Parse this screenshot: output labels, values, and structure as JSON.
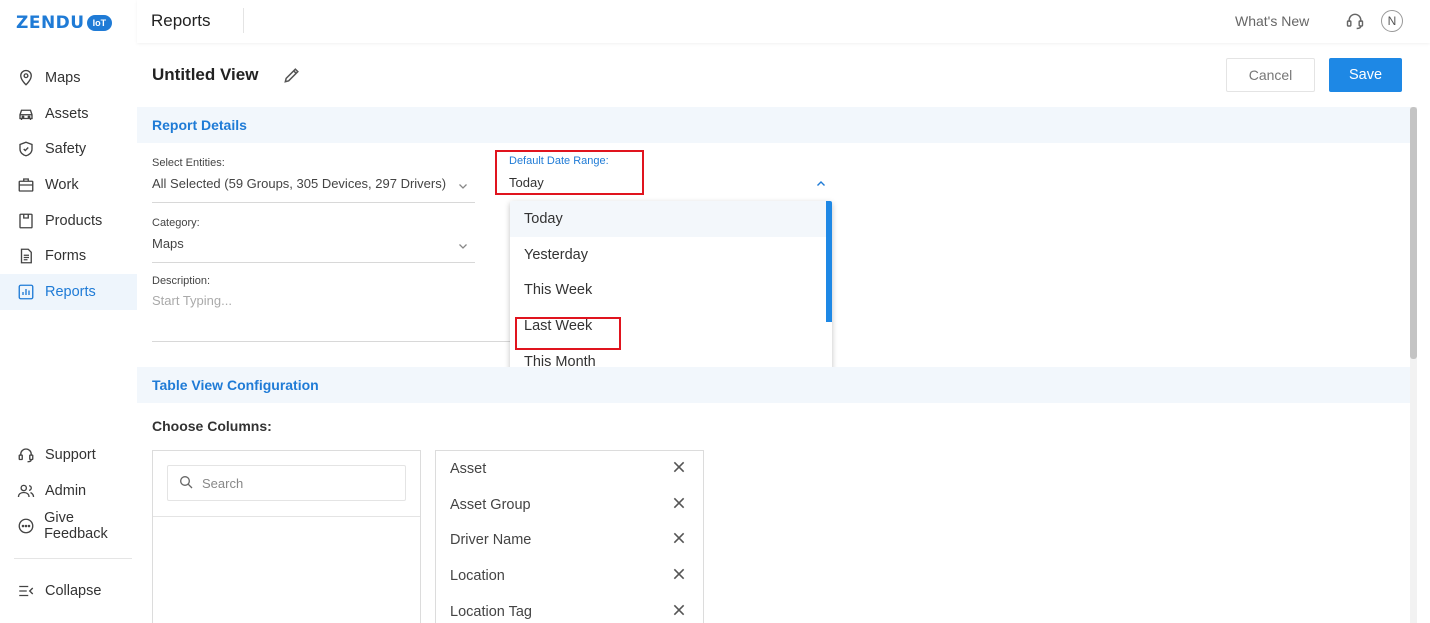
{
  "brand": {
    "logo_text": "ZENDU",
    "logo_badge": "IoT"
  },
  "sidebar": {
    "items": [
      {
        "label": "Maps",
        "icon": "map-pin-icon"
      },
      {
        "label": "Assets",
        "icon": "car-icon"
      },
      {
        "label": "Safety",
        "icon": "shield-icon"
      },
      {
        "label": "Work",
        "icon": "briefcase-icon"
      },
      {
        "label": "Products",
        "icon": "box-icon"
      },
      {
        "label": "Forms",
        "icon": "document-icon"
      },
      {
        "label": "Reports",
        "icon": "chart-icon",
        "active": true
      }
    ],
    "bottom": [
      {
        "label": "Support",
        "icon": "headset-icon"
      },
      {
        "label": "Admin",
        "icon": "users-icon"
      },
      {
        "label": "Give Feedback",
        "icon": "chat-icon"
      }
    ],
    "collapse_label": "Collapse"
  },
  "topbar": {
    "title": "Reports",
    "whats_new": "What's New",
    "avatar_initial": "N"
  },
  "header": {
    "view_title": "Untitled View",
    "cancel_label": "Cancel",
    "save_label": "Save"
  },
  "report_details": {
    "section_title": "Report Details",
    "entities": {
      "label": "Select Entities:",
      "value": "All Selected (59 Groups, 305 Devices, 297 Drivers)"
    },
    "category": {
      "label": "Category:",
      "value": "Maps"
    },
    "description": {
      "label": "Description:",
      "placeholder": "Start Typing..."
    },
    "date_range": {
      "label": "Default Date Range:",
      "value": "Today",
      "options": [
        "Today",
        "Yesterday",
        "This Week",
        "Last Week",
        "This Month"
      ]
    }
  },
  "table_config": {
    "section_title": "Table View Configuration",
    "choose_columns": "Choose Columns:",
    "search_placeholder": "Search",
    "selected_columns": [
      "Asset",
      "Asset Group",
      "Driver Name",
      "Location",
      "Location Tag"
    ]
  },
  "colors": {
    "accent": "#1e88e5",
    "highlight": "#e0141e",
    "band": "#f2f7fc"
  }
}
